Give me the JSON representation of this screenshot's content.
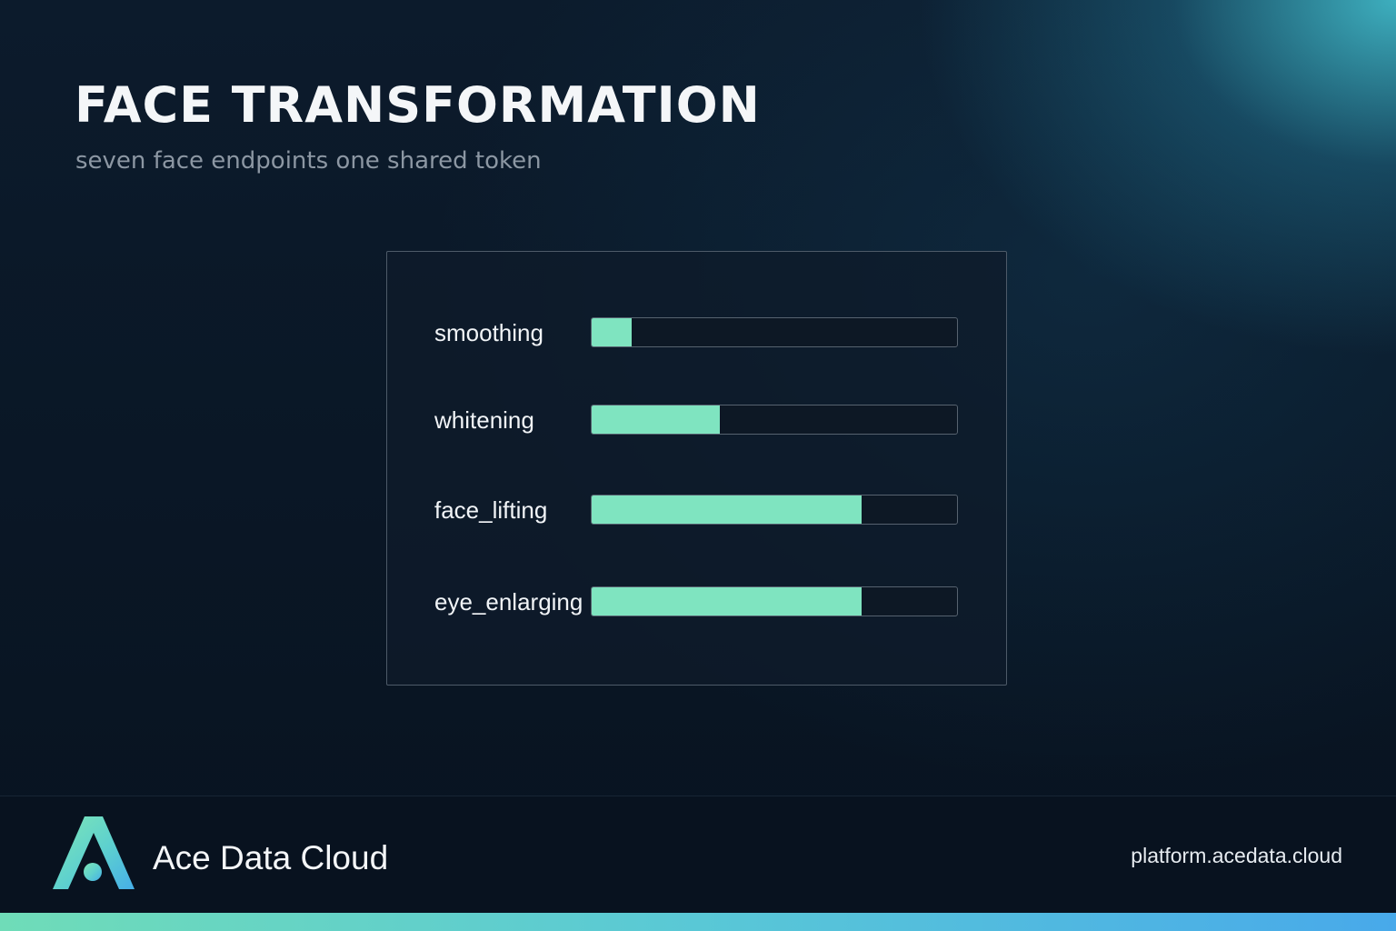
{
  "header": {
    "title": "FACE TRANSFORMATION",
    "subtitle": "seven face endpoints one shared token"
  },
  "panel": {
    "rows": [
      {
        "label": "smoothing",
        "value": 0.11
      },
      {
        "label": "whitening",
        "value": 0.35
      },
      {
        "label": "face_lifting",
        "value": 0.74
      },
      {
        "label": "eye_enlarging",
        "value": 0.74
      }
    ]
  },
  "footer": {
    "brand": "Ace Data Cloud",
    "url": "platform.acedata.cloud"
  },
  "colors": {
    "fill": "#7fe4c0",
    "accent_start": "#6fdcb8",
    "accent_end": "#48a9ea"
  }
}
